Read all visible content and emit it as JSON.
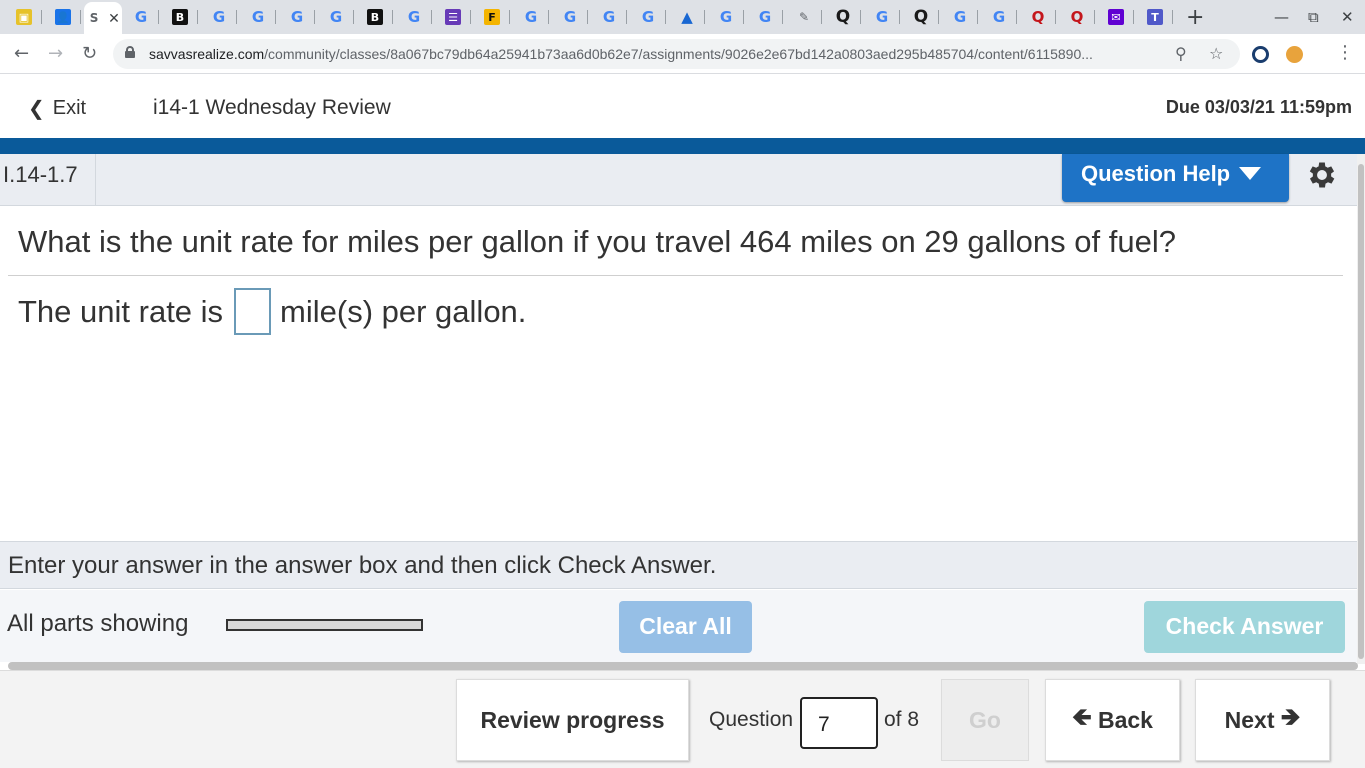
{
  "browser": {
    "tabs": [
      {
        "icon": "classroom-icon",
        "glyph": "▣"
      },
      {
        "icon": "contacts-icon",
        "glyph": "👤"
      },
      {
        "icon": "savvas-icon",
        "glyph": "S",
        "active": true
      },
      {
        "icon": "google-icon",
        "glyph": "G"
      },
      {
        "icon": "brainly-icon",
        "glyph": "B"
      },
      {
        "icon": "google-icon",
        "glyph": "G"
      },
      {
        "icon": "google-icon",
        "glyph": "G"
      },
      {
        "icon": "google-icon",
        "glyph": "G"
      },
      {
        "icon": "google-icon",
        "glyph": "G"
      },
      {
        "icon": "brainly-icon",
        "glyph": "B"
      },
      {
        "icon": "google-icon",
        "glyph": "G"
      },
      {
        "icon": "forms-icon",
        "glyph": "☰"
      },
      {
        "icon": "flipgrid-icon",
        "glyph": "F"
      },
      {
        "icon": "google-icon",
        "glyph": "G"
      },
      {
        "icon": "google-icon",
        "glyph": "G"
      },
      {
        "icon": "google-icon",
        "glyph": "G"
      },
      {
        "icon": "google-icon",
        "glyph": "G"
      },
      {
        "icon": "aftermath-icon",
        "glyph": "▲"
      },
      {
        "icon": "google-icon",
        "glyph": "G"
      },
      {
        "icon": "google-icon",
        "glyph": "G"
      },
      {
        "icon": "mathway-icon",
        "glyph": "✎"
      },
      {
        "icon": "quizlet-icon",
        "glyph": "Q"
      },
      {
        "icon": "google-icon",
        "glyph": "G"
      },
      {
        "icon": "quizlet-icon",
        "glyph": "Q"
      },
      {
        "icon": "google-icon",
        "glyph": "G"
      },
      {
        "icon": "google-icon",
        "glyph": "G"
      },
      {
        "icon": "quizizz-icon",
        "glyph": "Q"
      },
      {
        "icon": "quizizz-icon",
        "glyph": "Q"
      },
      {
        "icon": "yahoo-mail-icon",
        "glyph": "✉"
      },
      {
        "icon": "teams-icon",
        "glyph": "T"
      }
    ],
    "url_host": "savvasrealize.com",
    "url_path": "/community/classes/8a067bc79db64a25941b73aa6d0b62e7/assignments/9026e2e67bd142a0803aed295b485704/content/6115890..."
  },
  "header": {
    "exit_label": "Exit",
    "assignment_title": "i14-1 Wednesday Review",
    "due": "Due 03/03/21 11:59pm"
  },
  "question_bar": {
    "question_id": "I.14-1.7",
    "help_label": "Question Help"
  },
  "question": {
    "prompt": "What is the unit rate for miles per gallon if you travel 464 miles on 29 gallons of fuel?",
    "answer_prefix": "The unit rate is",
    "answer_suffix": "mile(s) per gallon."
  },
  "instruction": "Enter your answer in the answer box and then click Check Answer.",
  "actions": {
    "parts_label": "All parts showing",
    "clear_label": "Clear All",
    "check_label": "Check Answer"
  },
  "footer": {
    "review_label": "Review progress",
    "question_label": "Question",
    "question_number": "7",
    "of_label": "of 8",
    "go_label": "Go",
    "back_label": "Back",
    "next_label": "Next"
  },
  "colors": {
    "brand_blue_bar": "#0a5a9a",
    "help_button": "#1e73c6",
    "clear_button_disabled": "#96bfe6",
    "check_button_disabled": "#9fd6dc"
  }
}
